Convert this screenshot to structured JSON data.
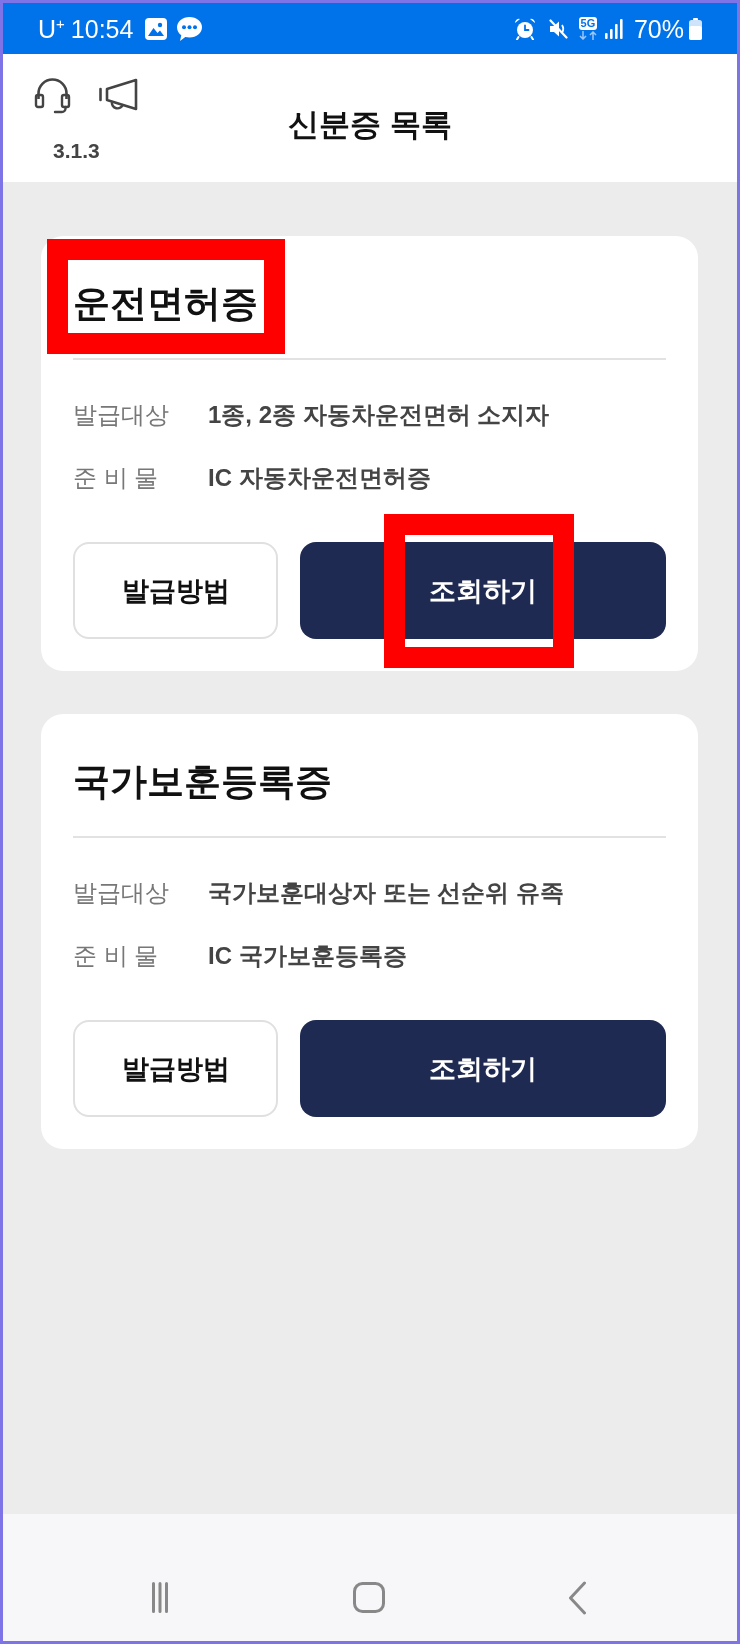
{
  "status_bar": {
    "carrier": "U$^{+}$",
    "time": "10:54",
    "network": "5G",
    "battery": "70%"
  },
  "header": {
    "title": "신분증 목록",
    "version": "3.1.3"
  },
  "cards": [
    {
      "title": "운전면허증",
      "title_highlighted": true,
      "details": [
        {
          "label": "발급대상",
          "value": "1종, 2종 자동차운전면허 소지자"
        },
        {
          "label": "준 비 물",
          "value": "IC 자동차운전면허증"
        }
      ],
      "buttons": [
        {
          "kind": "outline",
          "label": "발급방법",
          "highlighted": false
        },
        {
          "kind": "filled",
          "label": "조회하기",
          "highlighted": true
        }
      ]
    },
    {
      "title": "국가보훈등록증",
      "title_highlighted": false,
      "details": [
        {
          "label": "발급대상",
          "value": "국가보훈대상자 또는 선순위 유족"
        },
        {
          "label": "준 비 물",
          "value": "IC 국가보훈등록증"
        }
      ],
      "buttons": [
        {
          "kind": "outline",
          "label": "발급방법",
          "highlighted": false
        },
        {
          "kind": "filled",
          "label": "조회하기",
          "highlighted": false
        }
      ]
    }
  ]
}
